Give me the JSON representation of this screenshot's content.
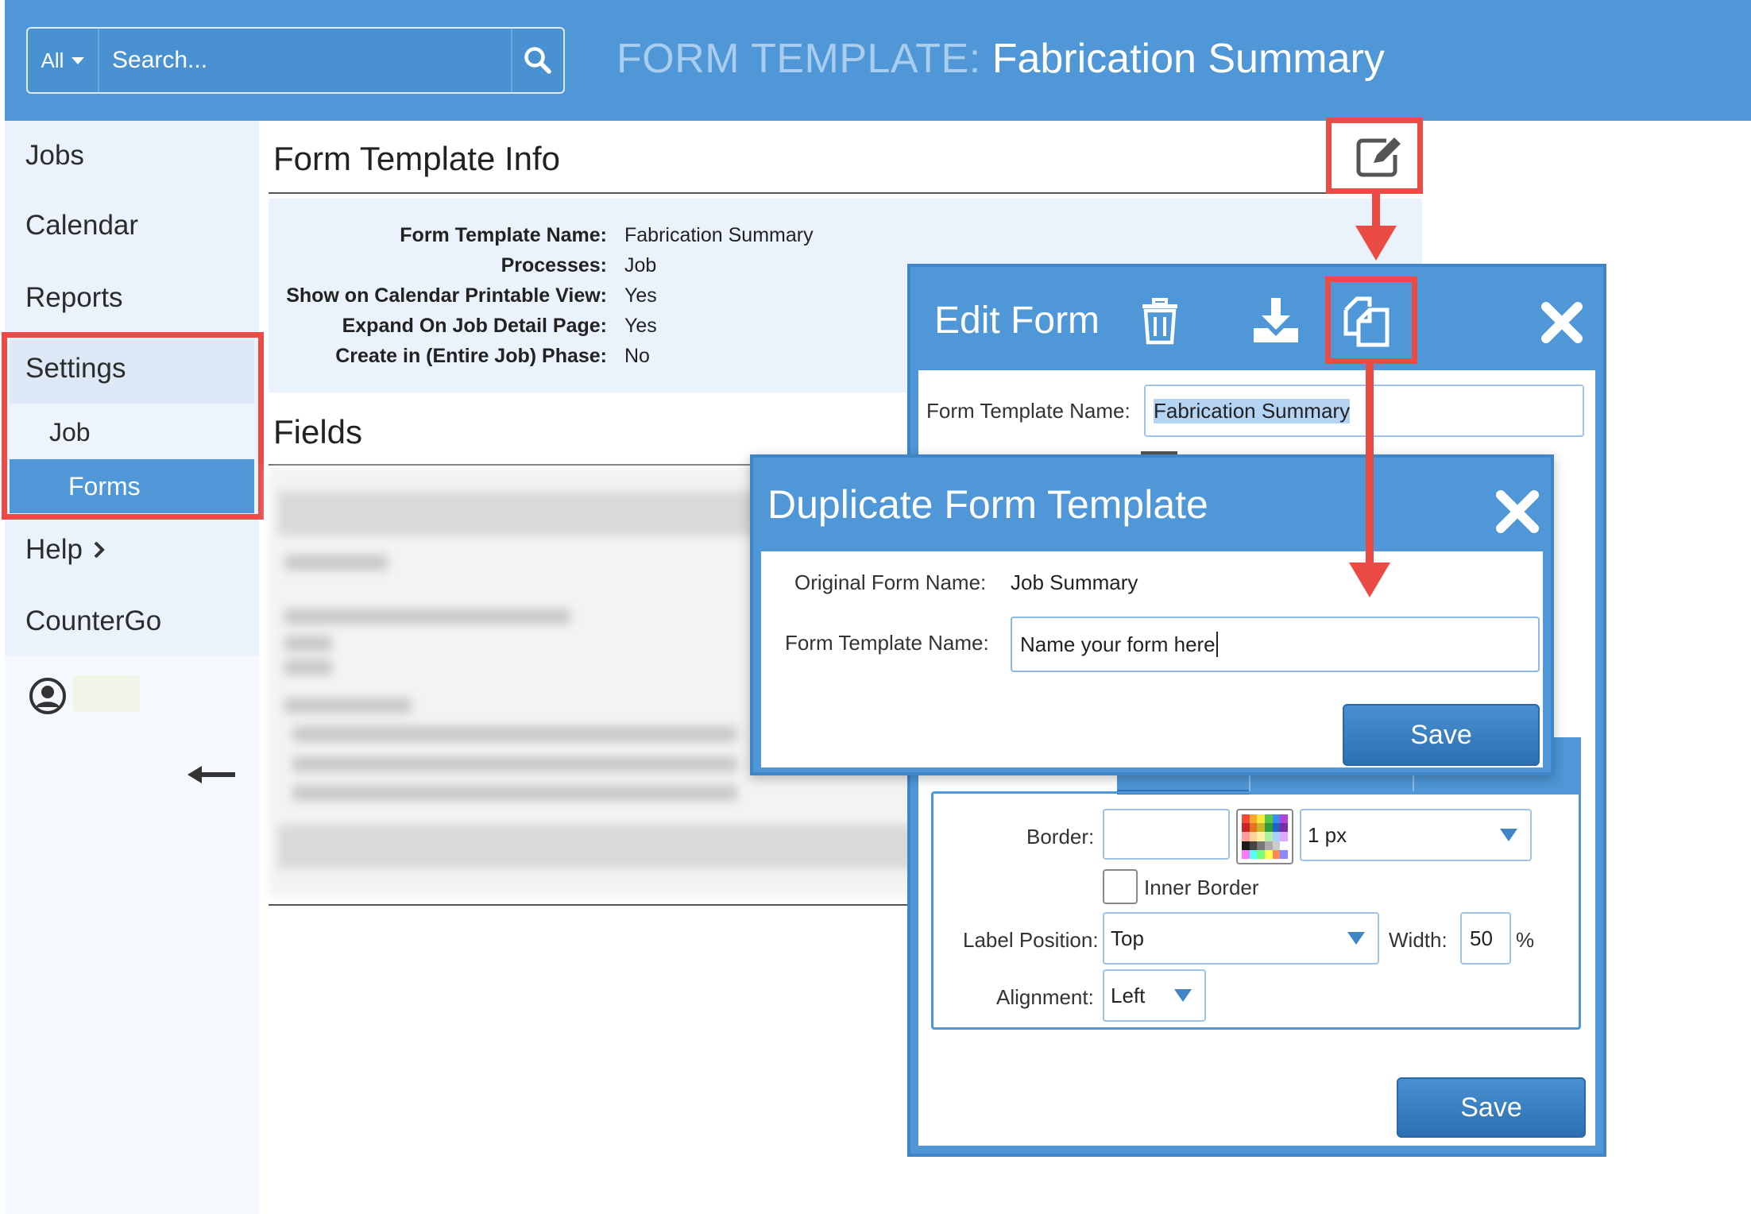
{
  "search": {
    "scope": "All",
    "placeholder": "Search..."
  },
  "header": {
    "prefix": "FORM TEMPLATE:",
    "name": "Fabrication Summary"
  },
  "sidebar": {
    "items": [
      "Jobs",
      "Calendar",
      "Reports",
      "Settings"
    ],
    "sub_items": [
      "Job",
      "Forms"
    ],
    "help": "Help",
    "countergo": "CounterGo"
  },
  "info": {
    "title": "Form Template Info",
    "rows": [
      {
        "label": "Form Template Name:",
        "value": "Fabrication Summary"
      },
      {
        "label": "Processes:",
        "value": "Job"
      },
      {
        "label": "Show on Calendar Printable View:",
        "value": "Yes"
      },
      {
        "label": "Expand On Job Detail Page:",
        "value": "Yes"
      },
      {
        "label": "Create in (Entire Job) Phase:",
        "value": "No"
      }
    ]
  },
  "fields": {
    "title": "Fields"
  },
  "edit_form": {
    "title": "Edit Form",
    "name_label": "Form Template Name:",
    "name_value": "Fabrication Summary",
    "border_label": "Border:",
    "border_width": "1 px",
    "inner_border": "Inner Border",
    "label_position_label": "Label Position:",
    "label_position": "Top",
    "width_label": "Width:",
    "width_value": "50",
    "width_unit": "%",
    "alignment_label": "Alignment:",
    "alignment": "Left",
    "save": "Save"
  },
  "duplicate": {
    "title": "Duplicate Form Template",
    "original_label": "Original Form Name:",
    "original_value": "Job Summary",
    "name_label": "Form Template Name:",
    "name_value": "Name your form here",
    "save": "Save"
  },
  "colors": {
    "header_blue": "#4f97d6",
    "highlight_red": "#ea4b45",
    "panel_blue": "#eaf3fb"
  }
}
